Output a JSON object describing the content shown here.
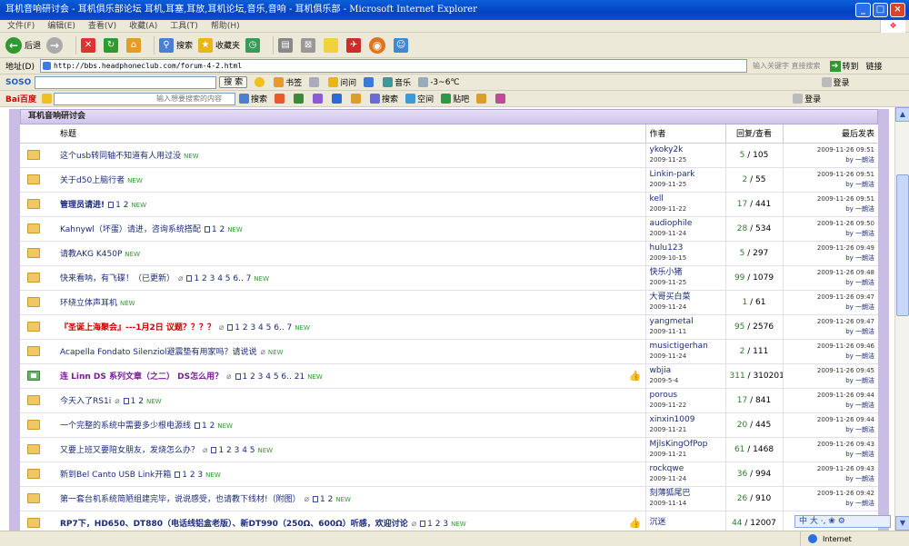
{
  "window": {
    "title": "耳机音响研讨会 - 耳机俱乐部论坛 耳机,耳塞,耳放,耳机论坛,音乐,音响 - 耳机俱乐部 - Microsoft Internet Explorer",
    "menu": [
      "文件(F)",
      "编辑(E)",
      "查看(V)",
      "收藏(A)",
      "工具(T)",
      "帮助(H)"
    ]
  },
  "toolbar": {
    "back": "后退",
    "search": "搜索",
    "favorites": "收藏夹"
  },
  "address": {
    "label": "地址(D)",
    "url": "http://bbs.headphoneclub.com/forum-4-2.html",
    "search_placeholder": "输入关键字 直接搜索",
    "go": "转到",
    "links": "链接"
  },
  "soso": {
    "logo": "SOSO",
    "search_btn": "搜 索",
    "bookmarks": "书签",
    "ask": "问问",
    "music": "音乐",
    "weather": "-3~6℃",
    "login": "登录"
  },
  "baidu": {
    "logo": "Bai百度",
    "input_placeholder": "输入想要搜索的内容",
    "search": "搜索",
    "space": "空间",
    "tieba": "贴吧",
    "login": "登录"
  },
  "forum": {
    "name": "耳机音响研讨会",
    "columns": {
      "title": "标题",
      "author": "作者",
      "stats": "回复/查看",
      "last": "最后发表"
    },
    "new_tag": "NEW",
    "threads": [
      {
        "title": "这个usb转同轴不知道有人用过没",
        "style": "normal",
        "pages": "",
        "clip": false,
        "thumb": false,
        "special": false,
        "author": "ykoky2k",
        "date": "2009-11-25",
        "replies": "5",
        "views": "105",
        "last_date": "2009-11-26 09:51",
        "last_by": "by 一朗洁"
      },
      {
        "title": "关于d50上脑行者",
        "style": "normal",
        "pages": "",
        "clip": false,
        "thumb": false,
        "special": false,
        "author": "Linkin-park",
        "date": "2009-11-25",
        "replies": "2",
        "views": "55",
        "last_date": "2009-11-26 09:51",
        "last_by": "by 一朗洁"
      },
      {
        "title": "管理员请进!",
        "style": "bold",
        "pages": "1 2",
        "clip": false,
        "thumb": false,
        "special": false,
        "author": "kell",
        "date": "2009-11-22",
        "replies": "17",
        "views": "441",
        "last_date": "2009-11-26 09:51",
        "last_by": "by 一朗洁"
      },
      {
        "title": "Kahnywl（坏蛋）请进，咨询系统搭配",
        "style": "normal",
        "pages": "1 2",
        "clip": false,
        "thumb": false,
        "special": false,
        "author": "audiophile",
        "date": "2009-11-24",
        "replies": "28",
        "views": "534",
        "last_date": "2009-11-26 09:50",
        "last_by": "by 一朗洁"
      },
      {
        "title": "请教AKG K450P",
        "style": "normal",
        "pages": "",
        "clip": false,
        "thumb": false,
        "special": false,
        "author": "hulu123",
        "date": "2009-10-15",
        "replies": "5",
        "views": "297",
        "last_date": "2009-11-26 09:49",
        "last_by": "by 一朗洁"
      },
      {
        "title": "快来看呐，有飞碟！（已更新）",
        "style": "normal",
        "pages": "1 2 3 4 5 6.. 7",
        "clip": true,
        "thumb": false,
        "special": false,
        "author": "快乐小猪",
        "date": "2009-11-25",
        "replies": "99",
        "views": "1079",
        "last_date": "2009-11-26 09:48",
        "last_by": "by 一朗洁"
      },
      {
        "title": "环绕立体声耳机",
        "style": "normal",
        "pages": "",
        "clip": false,
        "thumb": false,
        "special": false,
        "author": "大哥买白菜",
        "date": "2009-11-24",
        "replies": "1",
        "views": "61",
        "last_date": "2009-11-26 09:47",
        "last_by": "by 一朗洁"
      },
      {
        "title": "『圣诞上海聚会』---1月2日 议题？？？？",
        "style": "red",
        "pages": "1 2 3 4 5 6.. 7",
        "clip": true,
        "thumb": false,
        "special": false,
        "author": "yangmetal",
        "date": "2009-11-11",
        "replies": "95",
        "views": "2576",
        "last_date": "2009-11-26 09:47",
        "last_by": "by 一朗洁"
      },
      {
        "title": "Acapella Fondato Silenziol避震垫有用家吗？请说说",
        "style": "normal",
        "pages": "",
        "clip": true,
        "thumb": false,
        "special": false,
        "author": "musictigerhan",
        "date": "2009-11-24",
        "replies": "2",
        "views": "111",
        "last_date": "2009-11-26 09:46",
        "last_by": "by 一朗洁"
      },
      {
        "title": "连 Linn DS 系列文章（之二） DS怎么用？",
        "style": "purple",
        "pages": "1 2 3 4 5 6.. 21",
        "clip": true,
        "thumb": true,
        "special": true,
        "author": "wbjia",
        "date": "2009-5-4",
        "replies": "311",
        "views": "310201",
        "last_date": "2009-11-26 09:45",
        "last_by": "by 一朗洁"
      },
      {
        "title": "今天入了RS1i",
        "style": "normal",
        "pages": "1 2",
        "clip": true,
        "thumb": false,
        "special": false,
        "author": "porous",
        "date": "2009-11-22",
        "replies": "17",
        "views": "841",
        "last_date": "2009-11-26 09:44",
        "last_by": "by 一朗洁"
      },
      {
        "title": "一个完整的系统中需要多少根电源线",
        "style": "normal",
        "pages": "1 2",
        "clip": false,
        "thumb": false,
        "special": false,
        "author": "xinxin1009",
        "date": "2009-11-21",
        "replies": "20",
        "views": "445",
        "last_date": "2009-11-26 09:44",
        "last_by": "by 一朗洁"
      },
      {
        "title": "又要上班又要陪女朋友，发烧怎么办？",
        "style": "normal",
        "pages": "1 2 3 4 5",
        "clip": true,
        "thumb": false,
        "special": false,
        "author": "MjlsKingOfPop",
        "date": "2009-11-21",
        "replies": "61",
        "views": "1468",
        "last_date": "2009-11-26 09:43",
        "last_by": "by 一朗洁"
      },
      {
        "title": "新到Bel Canto USB Link开箱",
        "style": "normal",
        "pages": "1 2 3",
        "clip": false,
        "thumb": false,
        "special": false,
        "author": "rockqwe",
        "date": "2009-11-24",
        "replies": "36",
        "views": "994",
        "last_date": "2009-11-26 09:43",
        "last_by": "by 一朗洁"
      },
      {
        "title": "第一套台机系统简陋组建完毕，说说感受，也请教下线材!（附图）",
        "style": "normal",
        "pages": "1 2",
        "clip": true,
        "thumb": false,
        "special": false,
        "author": "刻薄狐尾巴",
        "date": "2009-11-14",
        "replies": "26",
        "views": "910",
        "last_date": "2009-11-26 09:42",
        "last_by": "by 一朗洁"
      },
      {
        "title": "RP7下，HD650、DT880（电话线铝盒老版）、新DT990（250Ω、600Ω）听感，欢迎讨论",
        "style": "bold",
        "pages": "1 2 3",
        "clip": true,
        "thumb": true,
        "special": false,
        "author": "沉迷",
        "date": "",
        "replies": "44",
        "views": "12007",
        "last_date": "",
        "last_by": ""
      }
    ]
  },
  "status": {
    "zone": "Internet"
  },
  "ime": "中 大 ·, ❀ ⚙"
}
